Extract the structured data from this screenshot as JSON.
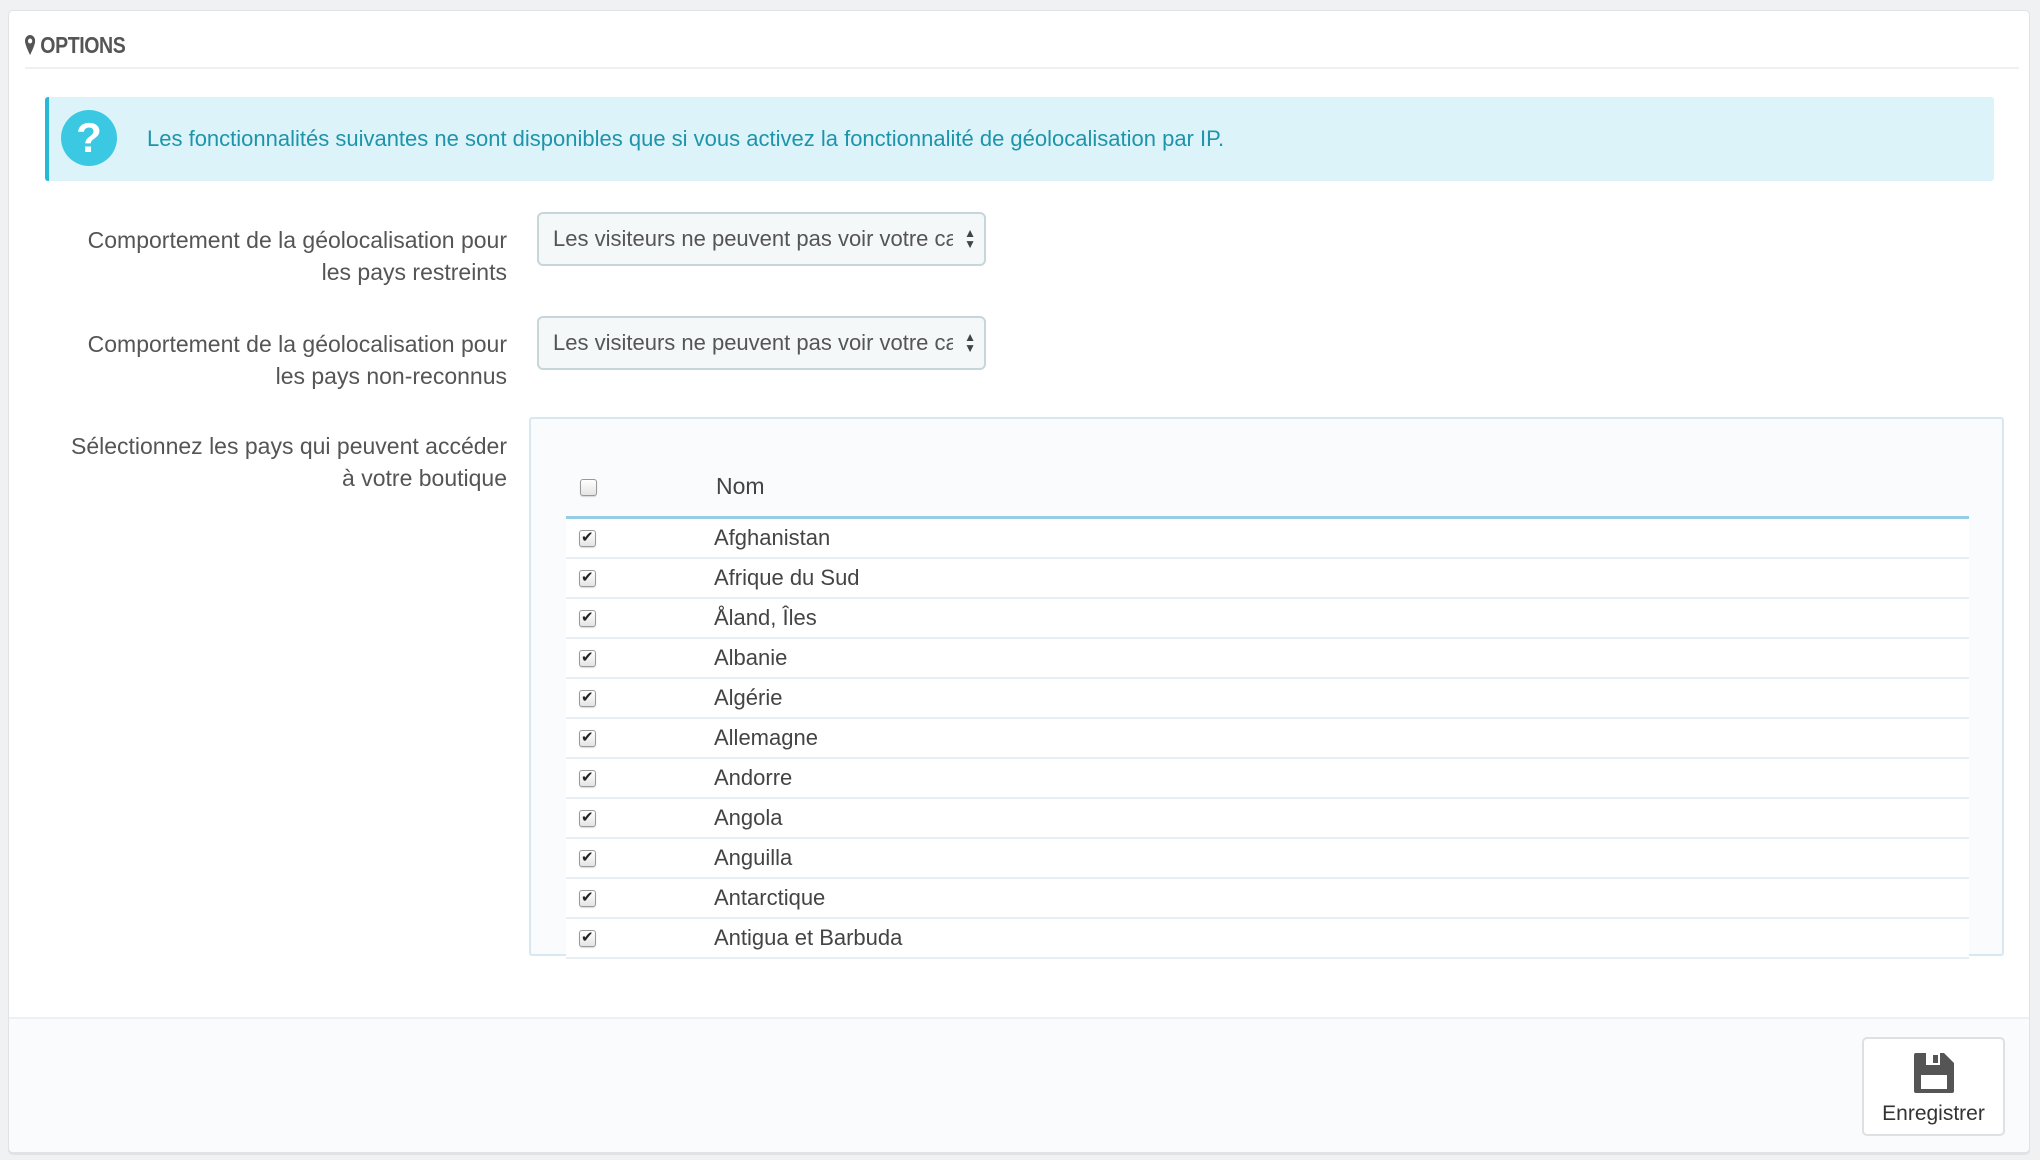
{
  "panel": {
    "title": "OPTIONS",
    "title_icon": "map-marker-icon"
  },
  "alert": {
    "icon": "question-circle-icon",
    "text": "Les fonctionnalités suivantes ne sont disponibles que si vous activez la fonctionnalité de géolocalisation par IP.",
    "accent": "#25b9d7"
  },
  "fields": [
    {
      "label_line1": "Comportement de la géolocalisation pour",
      "label_line2": "les pays restreints",
      "value": "Les visiteurs ne peuvent pas voir votre catalogue."
    },
    {
      "label_line1": "Comportement de la géolocalisation pour",
      "label_line2": "les pays non-reconnus",
      "value": "Les visiteurs ne peuvent pas voir votre catalogue."
    }
  ],
  "countries": {
    "label_line1": "Sélectionnez les pays qui peuvent accéder",
    "label_line2": "à votre boutique",
    "header_name": "Nom",
    "select_all_checked": false,
    "rows": [
      {
        "name": "Afghanistan",
        "checked": true
      },
      {
        "name": "Afrique du Sud",
        "checked": true
      },
      {
        "name": "Åland, Îles",
        "checked": true
      },
      {
        "name": "Albanie",
        "checked": true
      },
      {
        "name": "Algérie",
        "checked": true
      },
      {
        "name": "Allemagne",
        "checked": true
      },
      {
        "name": "Andorre",
        "checked": true
      },
      {
        "name": "Angola",
        "checked": true
      },
      {
        "name": "Anguilla",
        "checked": true
      },
      {
        "name": "Antarctique",
        "checked": true
      },
      {
        "name": "Antigua et Barbuda",
        "checked": true
      }
    ]
  },
  "footer": {
    "save_label": "Enregistrer",
    "save_icon": "floppy-disk-icon"
  }
}
